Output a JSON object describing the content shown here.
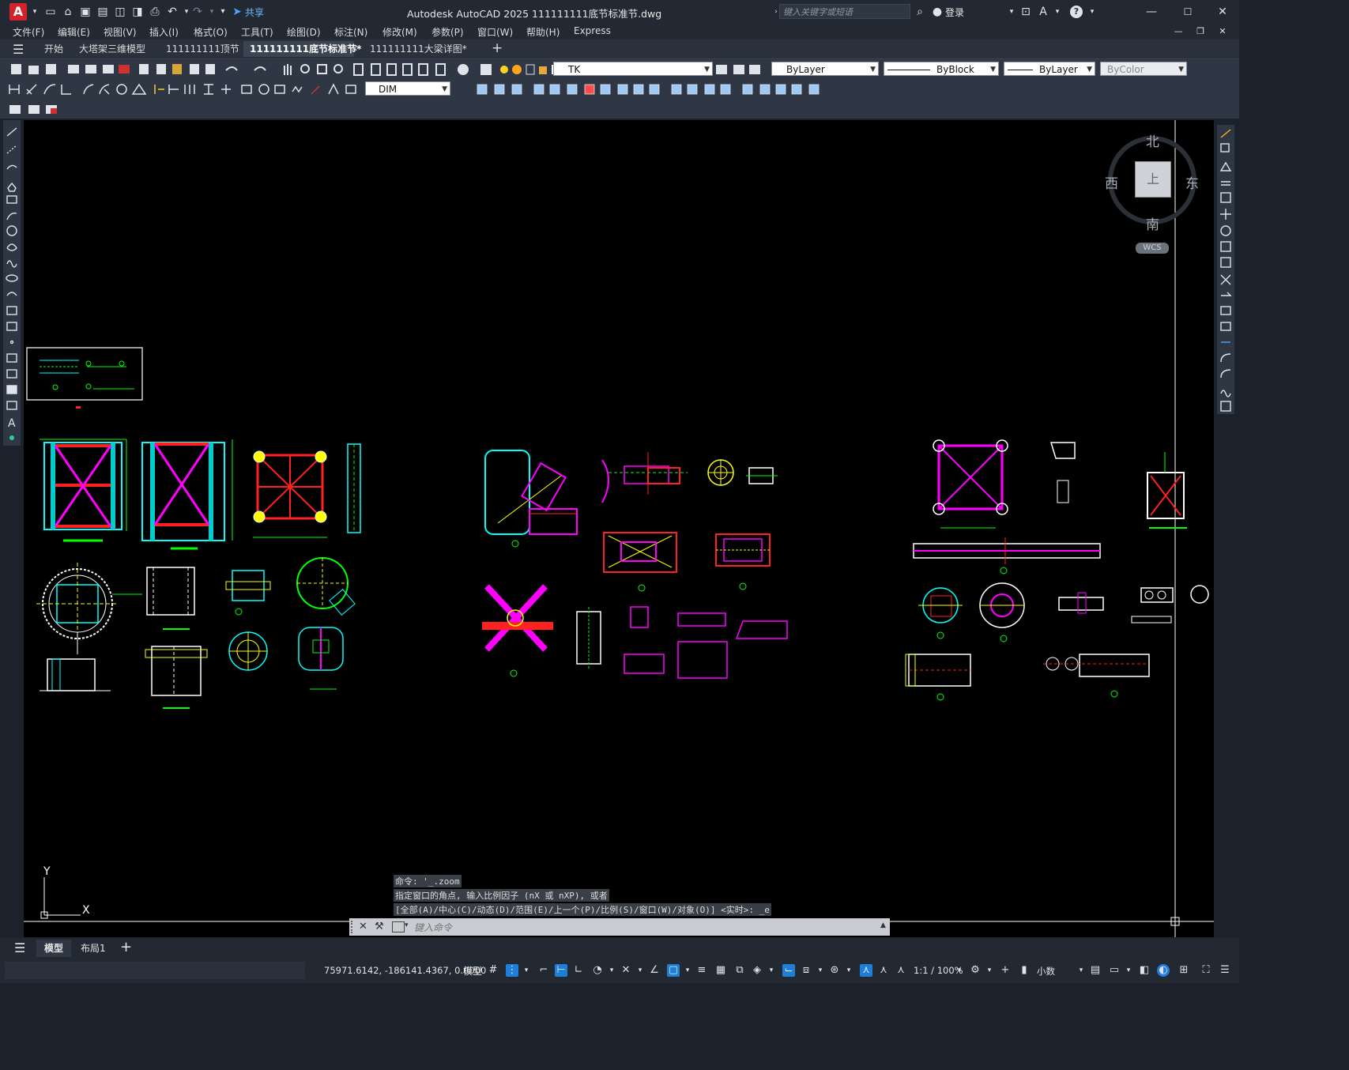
{
  "titlebar": {
    "app_logo": "A",
    "share_label": "共享",
    "title": "Autodesk AutoCAD 2025    111111111底节标准节.dwg",
    "search_placeholder": "键入关键字或短语",
    "login_label": "登录",
    "help_symbol": "?"
  },
  "menu": {
    "items": [
      "文件(F)",
      "编辑(E)",
      "视图(V)",
      "插入(I)",
      "格式(O)",
      "工具(T)",
      "绘图(D)",
      "标注(N)",
      "修改(M)",
      "参数(P)",
      "窗口(W)",
      "帮助(H)",
      "Express"
    ]
  },
  "tabs": {
    "items": [
      {
        "label": "开始",
        "active": false
      },
      {
        "label": "大塔架三维模型",
        "active": false
      },
      {
        "label": "111111111顶节",
        "active": false
      },
      {
        "label": "111111111底节标准节*",
        "active": true
      },
      {
        "label": "111111111大梁详图*",
        "active": false
      }
    ],
    "add_symbol": "+"
  },
  "toolbar": {
    "layer_value": "TK",
    "color_value": "ByLayer",
    "linetype_value": "ByBlock",
    "lineweight_value": "ByLayer",
    "plotstyle_value": "ByColor",
    "dimstyle_value": "DIM"
  },
  "viewcube": {
    "north": "北",
    "south": "南",
    "east": "东",
    "west": "西",
    "top_label": "上",
    "wcs_label": "WCS"
  },
  "ucs": {
    "y_label": "Y",
    "x_label": "X"
  },
  "command": {
    "history": [
      "命令: '_.zoom",
      "指定窗口的角点, 输入比例因子 (nX 或 nXP), 或者",
      "[全部(A)/中心(C)/动态(D)/范围(E)/上一个(P)/比例(S)/窗口(W)/对象(O)] <实时>: _e"
    ],
    "input_placeholder": "键入命令"
  },
  "layout_tabs": {
    "items": [
      {
        "label": "模型",
        "active": true
      },
      {
        "label": "布局1",
        "active": false
      }
    ],
    "add_symbol": "+"
  },
  "status": {
    "coordinates": "75971.6142, -186141.4367, 0.0000",
    "model_label": "模型",
    "scale_label": "1:1 / 100%",
    "units_label": "小数"
  },
  "colors": {
    "canvas_bg": "#000000",
    "chrome_bg": "#222933",
    "accent_blue": "#1f7fd8",
    "drawing_green": "#00ff00",
    "drawing_magenta": "#ff00ff",
    "drawing_cyan": "#00ffff",
    "drawing_red": "#ff2020",
    "drawing_yellow": "#ffff00"
  }
}
